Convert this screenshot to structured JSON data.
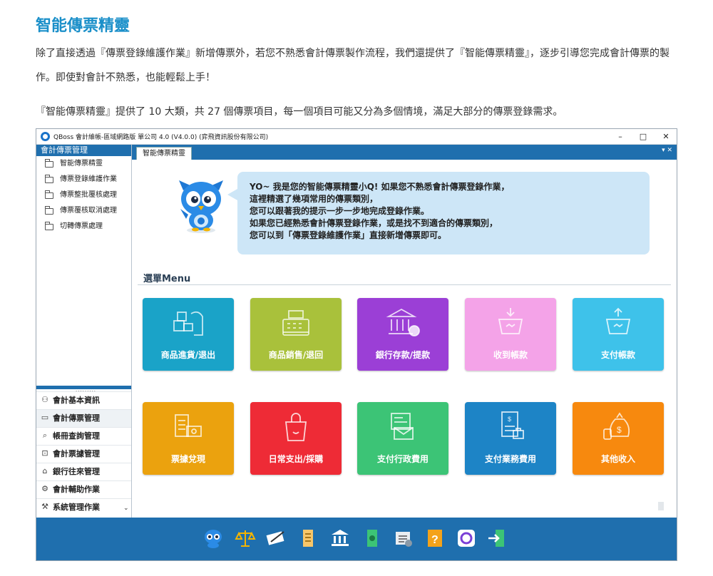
{
  "article": {
    "title": "智能傳票精靈",
    "para1": "除了直接透過『傳票登錄維護作業』新增傳票外，若您不熟悉會計傳票製作流程，我們還提供了『智能傳票精靈』，逐步引導您完成會計傳票的製作。即使對會計不熟悉，也能輕鬆上手！",
    "para2": "『智能傳票精靈』提供了 10 大類，共 27 個傳票項目，每一個項目可能又分為多個情境，滿足大部分的傳票登錄需求。"
  },
  "window": {
    "title": "QBoss 會計維帳-區域網路版 單公司 4.0 (V4.0.0) (弈飛資訊股份有限公司)",
    "min_label": "–",
    "max_label": "□",
    "close_label": "✕"
  },
  "sidebar": {
    "header": "會計傳票管理",
    "items": [
      {
        "label": "智能傳票精靈"
      },
      {
        "label": "傳票登錄維護作業"
      },
      {
        "label": "傳票整批覆核處理"
      },
      {
        "label": "傳票覆核取消處理"
      },
      {
        "label": "切轉傳票處理"
      }
    ],
    "nav": [
      {
        "label": "會計基本資訊",
        "icon": "person-icon"
      },
      {
        "label": "會計傳票管理",
        "icon": "folder-icon"
      },
      {
        "label": "帳冊查詢管理",
        "icon": "search-icon"
      },
      {
        "label": "會計票據管理",
        "icon": "ticket-icon"
      },
      {
        "label": "銀行往來管理",
        "icon": "bank-icon"
      },
      {
        "label": "會計輔助作業",
        "icon": "gear-icon"
      },
      {
        "label": "系統管理作業",
        "icon": "tools-icon"
      }
    ]
  },
  "tab": {
    "label": "智能傳票精靈",
    "controls": "▾ ✕"
  },
  "bubble": {
    "lines": [
      "YO~ 我是您的智能傳票精靈小Q! 如果您不熟悉會計傳票登錄作業，",
      "這裡精選了幾項常用的傳票類別，",
      "您可以跟著我的提示一步一步地完成登錄作業。",
      "如果您已經熟悉會計傳票登錄作業，或是找不到適合的傳票類別，",
      "您可以到「傳票登錄維護作業」直接新增傳票即可。"
    ]
  },
  "menu": {
    "title": "選單Menu",
    "tiles": [
      {
        "label": "商品進貨/退出",
        "color": "#1aa3c8",
        "icon": "goods-in-icon"
      },
      {
        "label": "商品銷售/退回",
        "color": "#a9c13b",
        "icon": "cash-register-icon"
      },
      {
        "label": "銀行存款/提款",
        "color": "#9b3fd6",
        "icon": "bank-icon"
      },
      {
        "label": "收到帳款",
        "color": "#f4a3e8",
        "icon": "receive-payment-icon"
      },
      {
        "label": "支付帳款",
        "color": "#3ec2ea",
        "icon": "pay-payment-icon"
      },
      {
        "label": "票據兌現",
        "color": "#eba20e",
        "icon": "bill-cash-icon"
      },
      {
        "label": "日常支出/採購",
        "color": "#ee2b36",
        "icon": "shopping-bag-icon"
      },
      {
        "label": "支付行政費用",
        "color": "#3cc476",
        "icon": "admin-expense-icon"
      },
      {
        "label": "支付業務費用",
        "color": "#1d84c6",
        "icon": "business-expense-icon"
      },
      {
        "label": "其他收入",
        "color": "#f7890e",
        "icon": "money-bag-icon"
      }
    ]
  },
  "dock": {
    "icons": [
      "mascot-icon",
      "scale-icon",
      "checkbook-icon",
      "receipt-icon",
      "bank-icon",
      "cash-icon",
      "report-icon",
      "help-icon",
      "qboss-logo-icon",
      "exit-icon"
    ]
  }
}
